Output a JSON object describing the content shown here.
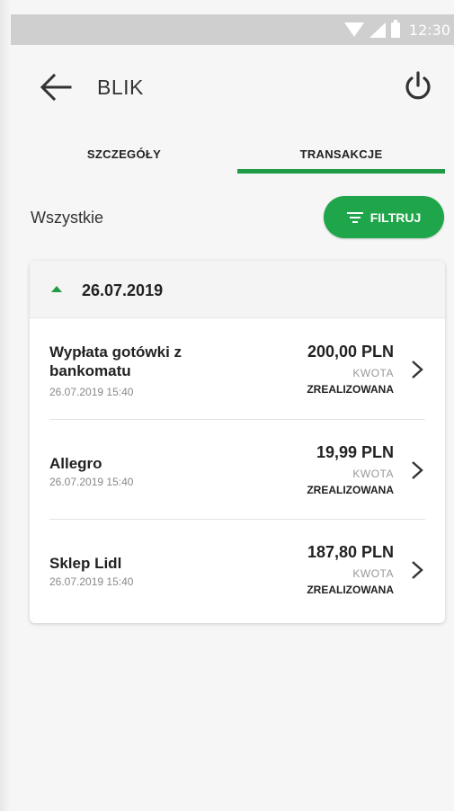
{
  "status_bar": {
    "time": "12:30"
  },
  "header": {
    "title": "BLIK"
  },
  "tabs": [
    {
      "label": "SZCZEGÓŁY",
      "active": false
    },
    {
      "label": "TRANSAKCJE",
      "active": true
    }
  ],
  "filter": {
    "label": "Wszystkie",
    "button_label": "FILTRUJ"
  },
  "group": {
    "date": "26.07.2019",
    "transactions": [
      {
        "name": "Wypłata gotówki z bankomatu",
        "datetime": "26.07.2019 15:40",
        "amount": "200,00 PLN",
        "amount_label": "KWOTA",
        "status": "ZREALIZOWANA"
      },
      {
        "name": "Allegro",
        "datetime": "26.07.2019 15:40",
        "amount": "19,99 PLN",
        "amount_label": "KWOTA",
        "status": "ZREALIZOWANA"
      },
      {
        "name": "Sklep Lidl",
        "datetime": "26.07.2019 15:40",
        "amount": "187,80 PLN",
        "amount_label": "KWOTA",
        "status": "ZREALIZOWANA"
      }
    ]
  },
  "colors": {
    "accent": "#1f9a45",
    "button": "#1fa64a",
    "status_bar": "#cfcfcf"
  }
}
